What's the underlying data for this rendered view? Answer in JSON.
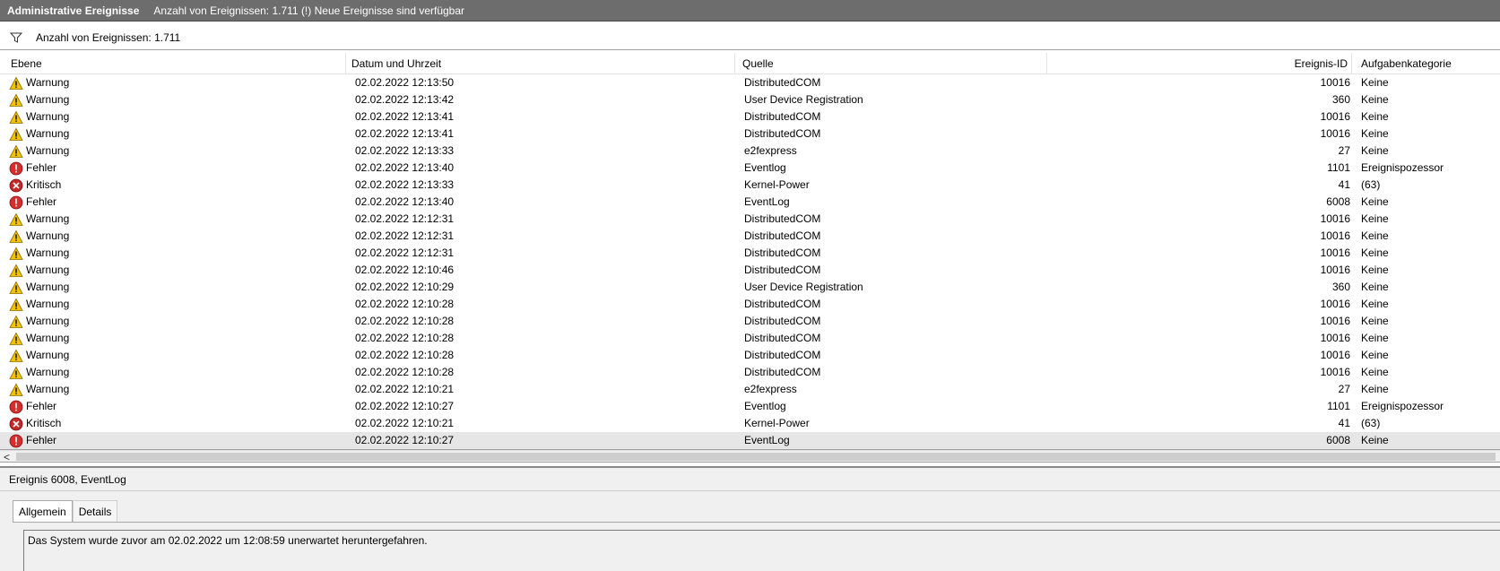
{
  "titlebar": {
    "title": "Administrative Ereignisse",
    "info": "Anzahl von Ereignissen: 1.711 (!) Neue Ereignisse sind verfügbar"
  },
  "toolbar": {
    "filter_icon": "filter-icon",
    "count": "Anzahl von Ereignissen: 1.711"
  },
  "columns": {
    "level": "Ebene",
    "date": "Datum und Uhrzeit",
    "source": "Quelle",
    "id": "Ereignis-ID",
    "category": "Aufgabenkategorie"
  },
  "level_icons": {
    "Warnung": "warning-icon",
    "Fehler": "error-icon",
    "Kritisch": "critical-icon"
  },
  "colors": {
    "warning": "#f2c300",
    "error": "#d32f2f",
    "critical": "#c62828",
    "selected_row": "#e6e6e6"
  },
  "events": [
    {
      "level": "Warnung",
      "date": "02.02.2022 12:13:50",
      "source": "DistributedCOM",
      "id": "10016",
      "category": "Keine"
    },
    {
      "level": "Warnung",
      "date": "02.02.2022 12:13:42",
      "source": "User Device Registration",
      "id": "360",
      "category": "Keine"
    },
    {
      "level": "Warnung",
      "date": "02.02.2022 12:13:41",
      "source": "DistributedCOM",
      "id": "10016",
      "category": "Keine"
    },
    {
      "level": "Warnung",
      "date": "02.02.2022 12:13:41",
      "source": "DistributedCOM",
      "id": "10016",
      "category": "Keine"
    },
    {
      "level": "Warnung",
      "date": "02.02.2022 12:13:33",
      "source": "e2fexpress",
      "id": "27",
      "category": "Keine"
    },
    {
      "level": "Fehler",
      "date": "02.02.2022 12:13:40",
      "source": "Eventlog",
      "id": "1101",
      "category": "Ereignispozessor"
    },
    {
      "level": "Kritisch",
      "date": "02.02.2022 12:13:33",
      "source": "Kernel-Power",
      "id": "41",
      "category": "(63)"
    },
    {
      "level": "Fehler",
      "date": "02.02.2022 12:13:40",
      "source": "EventLog",
      "id": "6008",
      "category": "Keine"
    },
    {
      "level": "Warnung",
      "date": "02.02.2022 12:12:31",
      "source": "DistributedCOM",
      "id": "10016",
      "category": "Keine"
    },
    {
      "level": "Warnung",
      "date": "02.02.2022 12:12:31",
      "source": "DistributedCOM",
      "id": "10016",
      "category": "Keine"
    },
    {
      "level": "Warnung",
      "date": "02.02.2022 12:12:31",
      "source": "DistributedCOM",
      "id": "10016",
      "category": "Keine"
    },
    {
      "level": "Warnung",
      "date": "02.02.2022 12:10:46",
      "source": "DistributedCOM",
      "id": "10016",
      "category": "Keine"
    },
    {
      "level": "Warnung",
      "date": "02.02.2022 12:10:29",
      "source": "User Device Registration",
      "id": "360",
      "category": "Keine"
    },
    {
      "level": "Warnung",
      "date": "02.02.2022 12:10:28",
      "source": "DistributedCOM",
      "id": "10016",
      "category": "Keine"
    },
    {
      "level": "Warnung",
      "date": "02.02.2022 12:10:28",
      "source": "DistributedCOM",
      "id": "10016",
      "category": "Keine"
    },
    {
      "level": "Warnung",
      "date": "02.02.2022 12:10:28",
      "source": "DistributedCOM",
      "id": "10016",
      "category": "Keine"
    },
    {
      "level": "Warnung",
      "date": "02.02.2022 12:10:28",
      "source": "DistributedCOM",
      "id": "10016",
      "category": "Keine"
    },
    {
      "level": "Warnung",
      "date": "02.02.2022 12:10:28",
      "source": "DistributedCOM",
      "id": "10016",
      "category": "Keine"
    },
    {
      "level": "Warnung",
      "date": "02.02.2022 12:10:21",
      "source": "e2fexpress",
      "id": "27",
      "category": "Keine"
    },
    {
      "level": "Fehler",
      "date": "02.02.2022 12:10:27",
      "source": "Eventlog",
      "id": "1101",
      "category": "Ereignispozessor"
    },
    {
      "level": "Kritisch",
      "date": "02.02.2022 12:10:21",
      "source": "Kernel-Power",
      "id": "41",
      "category": "(63)"
    },
    {
      "level": "Fehler",
      "date": "02.02.2022 12:10:27",
      "source": "EventLog",
      "id": "6008",
      "category": "Keine",
      "selected": true
    }
  ],
  "scrollbar": {
    "left_arrow": "<"
  },
  "detail": {
    "title": "Ereignis 6008, EventLog",
    "tabs": [
      "Allgemein",
      "Details"
    ],
    "active_tab": "Allgemein",
    "message": "Das System wurde zuvor am 02.02.2022 um 12:08:59 unerwartet heruntergefahren."
  }
}
